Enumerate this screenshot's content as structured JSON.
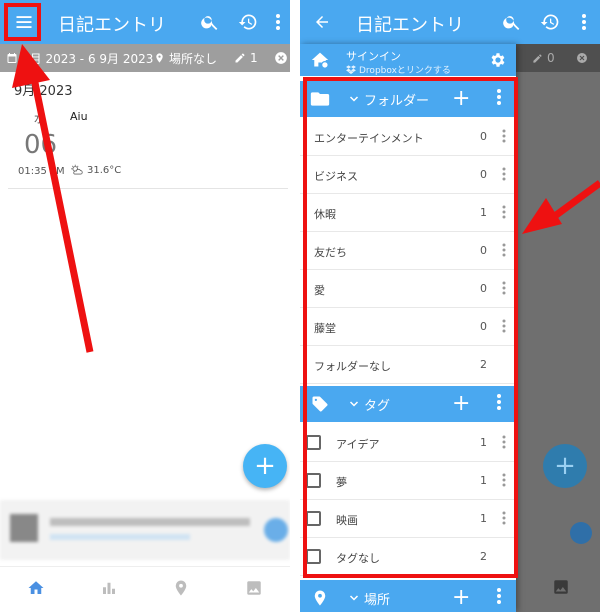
{
  "left": {
    "appbar": {
      "title": "日記エントリ"
    },
    "filter": {
      "date_range": "9月 2023 - 6 9月 2023",
      "location": "場所なし",
      "tag_count": "1"
    },
    "month_header": "9月 2023",
    "entry": {
      "dow": "水",
      "title": "Aiu",
      "day": "06",
      "time": "01:35 PM",
      "temperature": "31.6°C"
    },
    "fab_label": "+",
    "bottom_nav": [
      "home-icon",
      "chart-icon",
      "location-icon",
      "image-icon"
    ]
  },
  "right": {
    "appbar": {
      "title": "日記エントリ"
    },
    "filter": {
      "tag_count": "0"
    },
    "drawer": {
      "signin": {
        "title": "サインイン",
        "subtitle": "Dropboxとリンクする"
      },
      "folders_section": {
        "label": "フォルダー",
        "add": "+"
      },
      "folders": [
        {
          "name": "エンターテインメント",
          "count": "0"
        },
        {
          "name": "ビジネス",
          "count": "0"
        },
        {
          "name": "休暇",
          "count": "1"
        },
        {
          "name": "友だち",
          "count": "0"
        },
        {
          "name": "愛",
          "count": "0"
        },
        {
          "name": "藤堂",
          "count": "0"
        },
        {
          "name": "フォルダーなし",
          "count": "2"
        }
      ],
      "tags_section": {
        "label": "タグ",
        "add": "+"
      },
      "tags": [
        {
          "name": "アイデア",
          "count": "1"
        },
        {
          "name": "夢",
          "count": "1"
        },
        {
          "name": "映画",
          "count": "1"
        },
        {
          "name": "タグなし",
          "count": "2"
        }
      ],
      "places_section": {
        "label": "場所",
        "add": "+"
      }
    },
    "fab_label": "+"
  },
  "colors": {
    "primary": "#4aa8f0",
    "filter_bar": "#9e9e9e",
    "fab": "#46b4f5",
    "annotation": "#ee1111"
  }
}
